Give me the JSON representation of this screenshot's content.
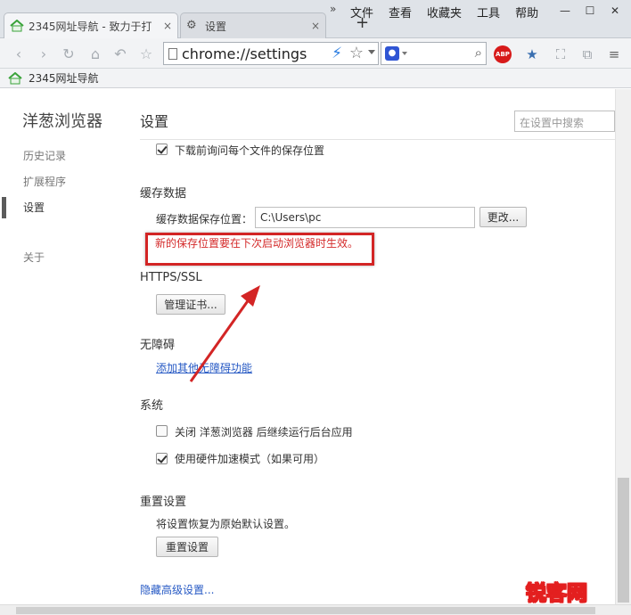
{
  "tabs": [
    {
      "title": "2345网址导航 - 致力于打",
      "close": "×"
    },
    {
      "title": "设置",
      "close": "×"
    }
  ],
  "tab_overflow": "»",
  "new_tab": "+",
  "menu": [
    "文件",
    "查看",
    "收藏夹",
    "工具",
    "帮助"
  ],
  "window_controls": {
    "minimize": "—",
    "maximize": "☐",
    "close": "✕"
  },
  "toolbar": {
    "url": "chrome://settings",
    "search_placeholder": ""
  },
  "bookmarks": [
    {
      "label": "2345网址导航"
    }
  ],
  "sidebar": {
    "brand": "洋葱浏览器",
    "items": [
      {
        "label": "历史记录"
      },
      {
        "label": "扩展程序"
      },
      {
        "label": "设置"
      },
      {
        "label": "关于"
      }
    ]
  },
  "main": {
    "title": "设置",
    "search_placeholder": "在设置中搜索",
    "download_ask": "下载前询问每个文件的保存位置",
    "cache": {
      "heading": "缓存数据",
      "location_label": "缓存数据保存位置：",
      "location_value": "C:\\Users\\pc",
      "change_button": "更改...",
      "notice": "新的保存位置要在下次启动浏览器时生效。"
    },
    "https": {
      "heading": "HTTPS/SSL",
      "manage_button": "管理证书..."
    },
    "accessibility": {
      "heading": "无障碍",
      "link": "添加其他无障碍功能"
    },
    "system": {
      "heading": "系统",
      "background_apps": "关闭 洋葱浏览器 后继续运行后台应用",
      "hardware_accel": "使用硬件加速模式（如果可用）"
    },
    "reset": {
      "heading": "重置设置",
      "description": "将设置恢复为原始默认设置。",
      "button": "重置设置"
    },
    "hide_advanced": "隐藏高级设置..."
  },
  "watermark": {
    "text": "锐客网"
  },
  "colors": {
    "annotation_red": "#d32525",
    "link_blue": "#2659c4"
  }
}
